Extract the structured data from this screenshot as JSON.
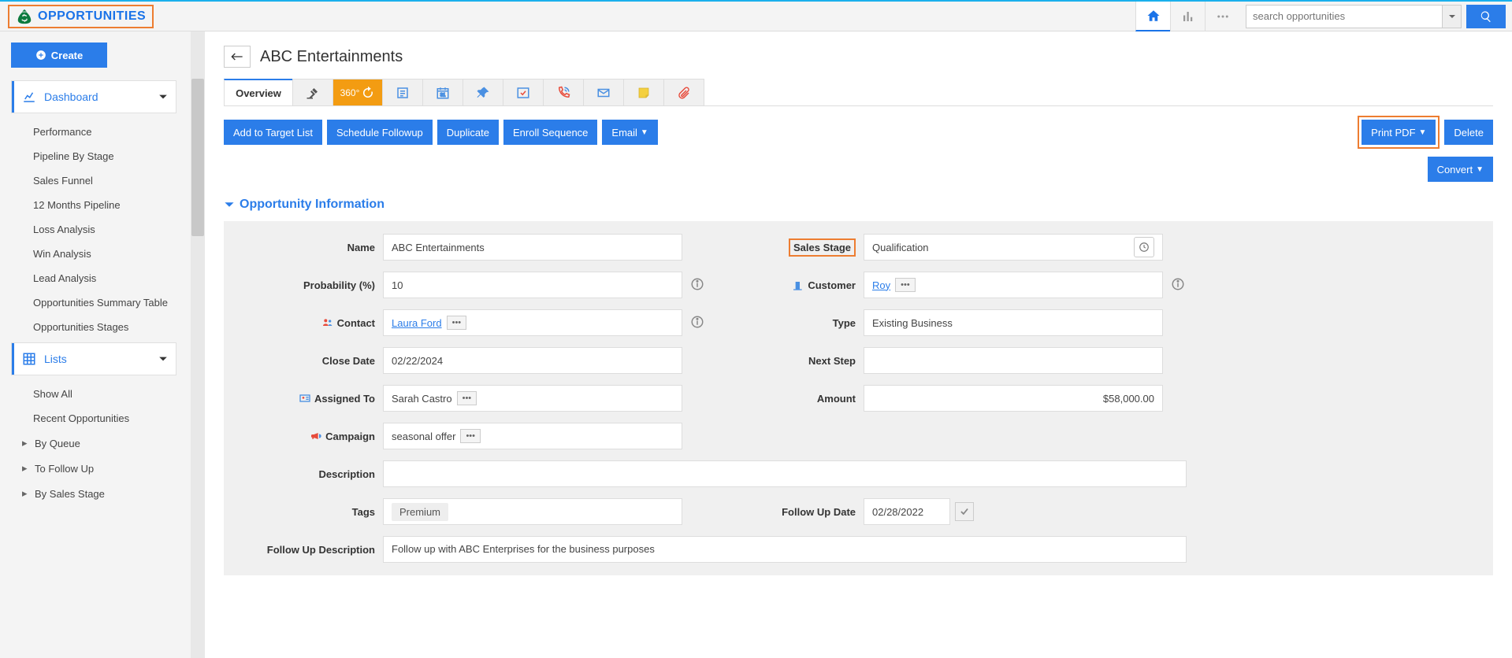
{
  "header": {
    "module_title": "OPPORTUNITIES",
    "search_placeholder": "search opportunities"
  },
  "sidebar": {
    "create_label": "Create",
    "sections": {
      "dashboard": {
        "title": "Dashboard",
        "items": [
          "Performance",
          "Pipeline By Stage",
          "Sales Funnel",
          "12 Months Pipeline",
          "Loss Analysis",
          "Win Analysis",
          "Lead Analysis",
          "Opportunities Summary Table",
          "Opportunities Stages"
        ]
      },
      "lists": {
        "title": "Lists",
        "items": [
          "Show All",
          "Recent Opportunities",
          "By Queue",
          "To Follow Up",
          "By Sales Stage"
        ]
      }
    }
  },
  "record": {
    "title": "ABC Entertainments",
    "tabs": {
      "overview": "Overview",
      "three60": "360°"
    },
    "actions": {
      "target": "Add to Target List",
      "followup": "Schedule Followup",
      "duplicate": "Duplicate",
      "enroll": "Enroll Sequence",
      "email": "Email",
      "print": "Print PDF",
      "delete": "Delete",
      "convert": "Convert"
    },
    "section_title": "Opportunity Information",
    "fields": {
      "name_label": "Name",
      "name_value": "ABC Entertainments",
      "stage_label": "Sales Stage",
      "stage_value": "Qualification",
      "prob_label": "Probability (%)",
      "prob_value": "10",
      "customer_label": "Customer",
      "customer_value": "Roy",
      "contact_label": "Contact",
      "contact_value": "Laura Ford",
      "type_label": "Type",
      "type_value": "Existing Business",
      "close_label": "Close Date",
      "close_value": "02/22/2024",
      "next_label": "Next Step",
      "next_value": "",
      "assigned_label": "Assigned To",
      "assigned_value": "Sarah Castro",
      "amount_label": "Amount",
      "amount_value": "$58,000.00",
      "campaign_label": "Campaign",
      "campaign_value": "seasonal offer",
      "desc_label": "Description",
      "desc_value": "",
      "tags_label": "Tags",
      "tags_value": "Premium",
      "fudate_label": "Follow Up Date",
      "fudate_value": "02/28/2022",
      "fudesc_label": "Follow Up Description",
      "fudesc_value": "Follow up with ABC Enterprises for the business purposes"
    }
  }
}
